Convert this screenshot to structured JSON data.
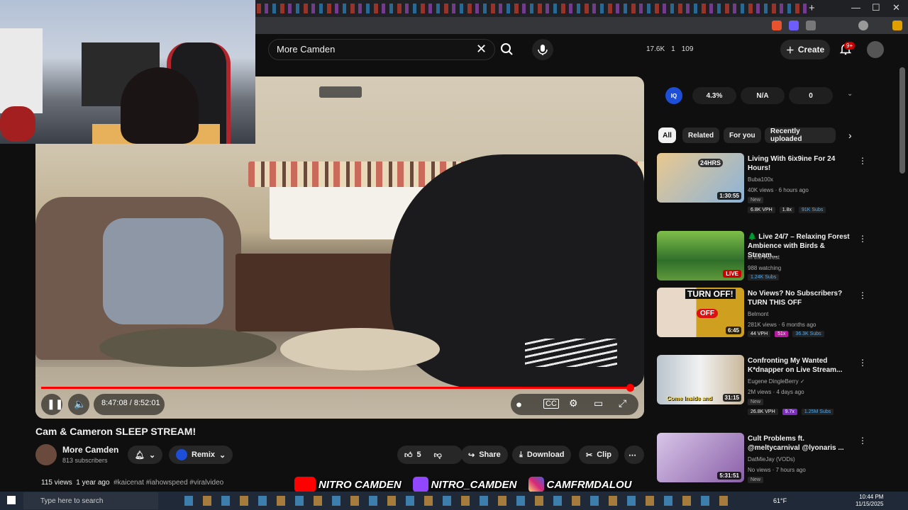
{
  "search": {
    "query": "More Camden"
  },
  "header_stats": {
    "views": "17.6K",
    "a": "1",
    "b": "109"
  },
  "header": {
    "create_label": "Create",
    "notif_count": "9+"
  },
  "player": {
    "time": "8:47:08 / 8:52:01",
    "progress_fraction": 0.9907
  },
  "video": {
    "title": "Cam & Cameron SLEEP STREAM!",
    "channel": "More Camden",
    "subscribers": "813 subscribers",
    "remix_label": "Remix",
    "likes": "5",
    "share_label": "Share",
    "download_label": "Download",
    "clip_label": "Clip",
    "views": "115 views",
    "age": "1 year ago",
    "tags": "#kaicenat #iahowspeed #viralvideo"
  },
  "extension": {
    "logo": "IQ",
    "pct": "4.3%",
    "na": "N/A",
    "zero": "0"
  },
  "chips": [
    "All",
    "Related",
    "For you",
    "Recently uploaded"
  ],
  "recs": [
    {
      "title": "Living With 6ix9ine For 24 Hours!",
      "channel": "Buba100x",
      "meta": "40K views · 6 hours ago",
      "badge": "New",
      "duration": "1:30:55",
      "stats": [
        "6.8K VPH",
        "1.8x",
        "91K Subs"
      ]
    },
    {
      "title": "🌲 Live 24/7 – Relaxing Forest Ambience with Birds & Stream...",
      "channel": "In the Forest",
      "meta": "988 watching",
      "badge": "",
      "duration": "LIVE",
      "stats": [
        "1.24K Subs"
      ]
    },
    {
      "title": "No Views? No Subscribers? TURN THIS OFF",
      "channel": "Belmont",
      "meta": "281K views · 6 months ago",
      "badge": "",
      "duration": "6:45",
      "stats": [
        "44 VPH",
        "51x",
        "36.3K Subs"
      ]
    },
    {
      "title": "Confronting My Wanted K*dnapper on Live Stream...",
      "channel": "Eugene DingleBerry ✓",
      "meta": "2M views · 4 days ago",
      "badge": "New",
      "duration": "31:15",
      "stats": [
        "26.8K VPH",
        "9.7x",
        "1.25M Subs"
      ]
    },
    {
      "title": "Cult Problems ft. @meltycarnival @lyonaris ...",
      "channel": "DatMieJay (VODs)",
      "meta": "No views · 7 hours ago",
      "badge": "New",
      "duration": "5:31:51",
      "stats": []
    }
  ],
  "socials": [
    "NITRO CAMDEN",
    "NITRO_CAMDEN",
    "CAMFRMDALOU"
  ],
  "thumb_texts": {
    "r1": "24HRS",
    "r3": "TURN OFF!",
    "r3b": "OFF",
    "r4": "Come Inside and"
  },
  "taskbar": {
    "search_placeholder": "Type here to search",
    "weather": "61°F",
    "time": "10:44 PM",
    "date": "11/15/2025"
  },
  "colors": {
    "accent": "#ff0000",
    "bg": "#0f0f0f",
    "chip_active": "#f1f1f1"
  }
}
